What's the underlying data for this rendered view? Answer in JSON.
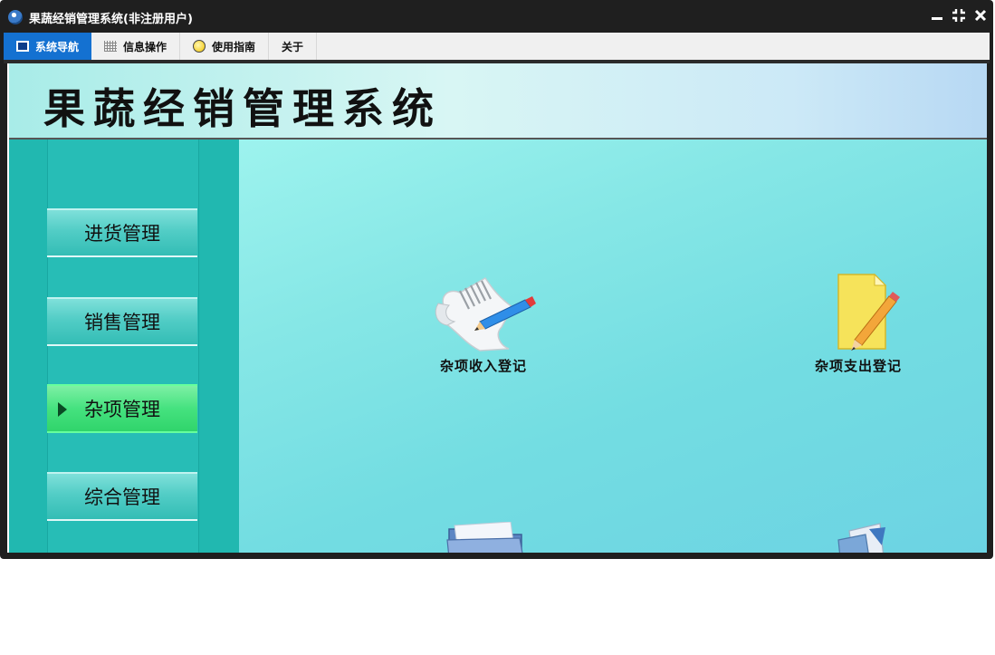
{
  "window": {
    "title": "果蔬经销管理系统(非注册用户)"
  },
  "tabs": [
    {
      "label": "系统导航",
      "active": true,
      "icon": "monitor-icon"
    },
    {
      "label": "信息操作",
      "active": false,
      "icon": "grid-icon"
    },
    {
      "label": "使用指南",
      "active": false,
      "icon": "bulb-icon"
    },
    {
      "label": "关于",
      "active": false,
      "icon": ""
    }
  ],
  "banner": {
    "title": "果蔬经销管理系统"
  },
  "sidebar": {
    "items": [
      {
        "label": "进货管理",
        "active": false
      },
      {
        "label": "销售管理",
        "active": false
      },
      {
        "label": "杂项管理",
        "active": true
      },
      {
        "label": "综合管理",
        "active": false
      }
    ]
  },
  "tiles": [
    {
      "label": "杂项收入登记",
      "icon": "paper-pencil-icon"
    },
    {
      "label": "杂项支出登记",
      "icon": "note-pencil-icon"
    },
    {
      "label": "",
      "icon": "folder-icon"
    },
    {
      "label": "",
      "icon": "document-icon"
    }
  ],
  "colors": {
    "title_bar": "#1f1f1f",
    "active_tab": "#1471d1",
    "sidebar": "#21b8b0",
    "active_nav": "#45e27f",
    "main_bg": "#86e7e6"
  }
}
